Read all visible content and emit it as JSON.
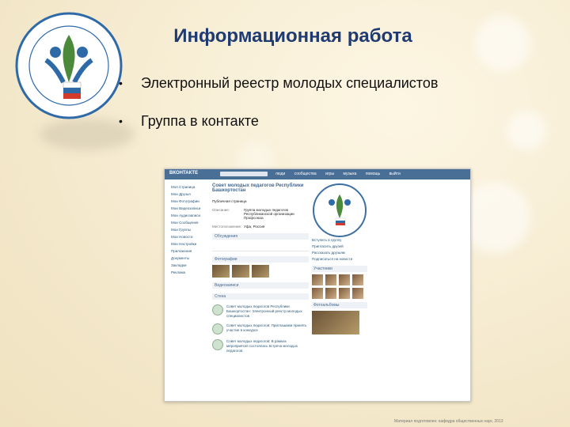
{
  "slide": {
    "title": "Информационная работа",
    "bullets": [
      "Электронный реестр молодых специалистов",
      "Группа в контакте"
    ],
    "footer": "Материал подготовлен: кафедра общественных наук, 2013"
  },
  "vk": {
    "logo": "ВКОНТАКТЕ",
    "nav": [
      "люди",
      "сообщества",
      "игры",
      "музыка",
      "помощь",
      "выйти"
    ],
    "side_menu": [
      "Моя Страница",
      "Мои Друзья",
      "Мои Фотографии",
      "Мои Видеозаписи",
      "Мои Аудиозаписи",
      "Мои Сообщения",
      "Мои Группы",
      "Мои Новости",
      "Мои Настройки",
      "Приложения",
      "Документы",
      "Закладки",
      "Реклама"
    ],
    "group_name": "Совет молодых педагогов Республики Башкортостан",
    "group_subtitle": "Публичная страница",
    "status": "Группа молодых педагогов",
    "info": [
      {
        "k": "Описание:",
        "v": "Группа молодых педагогов Республиканской организации Профсоюза"
      },
      {
        "k": "Местоположение:",
        "v": "Уфа, Россия"
      }
    ],
    "sections": [
      "Обсуждения",
      "Фотографии",
      "Видеозаписи",
      "Стена"
    ],
    "post_texts": [
      "Совет молодых педагогов Республики Башкортостан: Электронный реестр молодых специалистов",
      "Совет молодых педагогов: Приглашаем принять участие в конкурсе",
      "Совет молодых педагогов: В рамках мероприятия состоялась встреча молодых педагогов"
    ],
    "right_links": [
      "Вступить в группу",
      "Пригласить друзей",
      "Рассказать друзьям",
      "Подписаться на новости"
    ],
    "right_heads": [
      "Участники",
      "Фотоальбомы"
    ]
  },
  "colors": {
    "title": "#1f3b72",
    "vk_header": "#4a6f96",
    "vk_link": "#2b587a"
  }
}
